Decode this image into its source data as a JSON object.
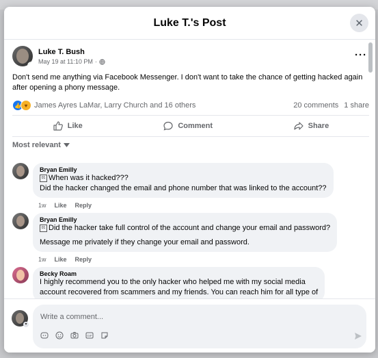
{
  "modal": {
    "title": "Luke T.'s Post",
    "close_icon": "close-icon"
  },
  "post": {
    "author": "Luke T. Bush",
    "timestamp": "May 19 at 11:10 PM",
    "privacy_icon": "globe-icon",
    "text": "Don't send me anything via Facebook Messenger.  I don't want to take the chance of getting hacked again after opening a phony message.",
    "reactions": {
      "types": [
        "like",
        "care"
      ],
      "names": "James Ayres LaMar, Larry Church and 16 others",
      "comments": "20 comments",
      "shares": "1 share"
    },
    "actions": {
      "like": "Like",
      "comment": "Comment",
      "share": "Share"
    }
  },
  "sort_label": "Most relevant",
  "comments": [
    {
      "name": "Bryan Emilly",
      "lines": [
        "When was it hacked???",
        "Did the hacker changed the email and phone number that was linked to the account??"
      ],
      "age": "1w",
      "like": "Like",
      "reply": "Reply"
    },
    {
      "name": "Bryan Emilly",
      "lines": [
        "Did the hacker take full control of the account and change your email and password?",
        "Message me privately if they change your email and password."
      ],
      "age": "1w",
      "like": "Like",
      "reply": "Reply"
    },
    {
      "name": "Becky Roam",
      "lines": [
        "I highly recommend you to the only hacker who helped me with my social media",
        "account recovered from scammers and my friends. You can reach him for all type of"
      ]
    }
  ],
  "composer": {
    "placeholder": "Write a comment...",
    "tools": [
      "avatar-sticker-icon",
      "emoji-icon",
      "camera-icon",
      "gif-icon",
      "sticker-icon"
    ],
    "send_icon": "send-icon"
  }
}
